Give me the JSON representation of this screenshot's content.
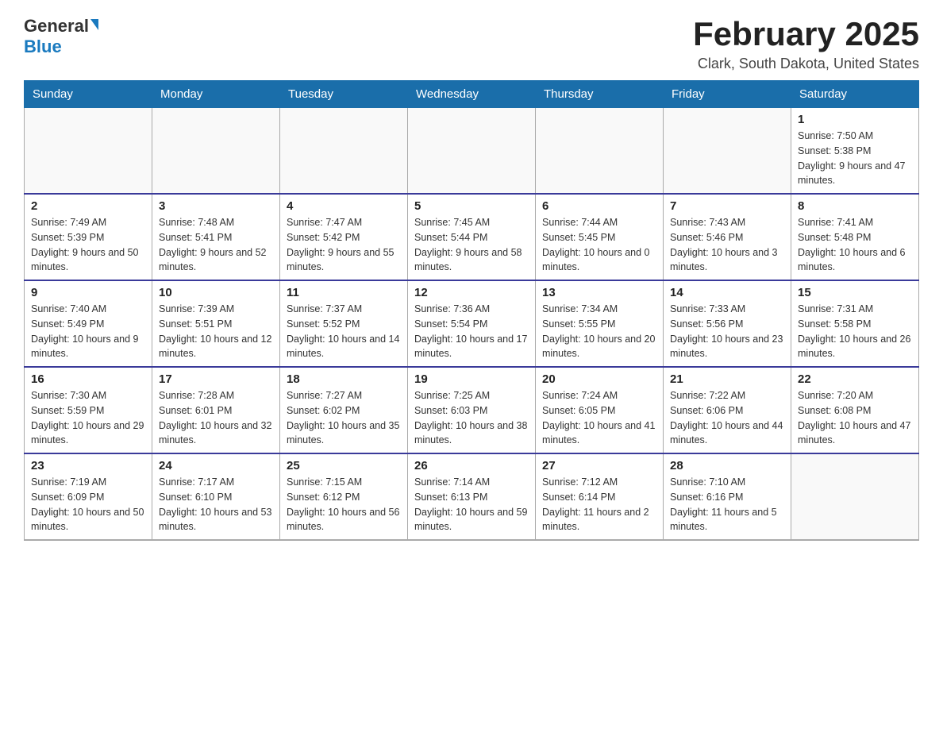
{
  "logo": {
    "general": "General",
    "blue": "Blue"
  },
  "title": {
    "month_year": "February 2025",
    "location": "Clark, South Dakota, United States"
  },
  "headers": [
    "Sunday",
    "Monday",
    "Tuesday",
    "Wednesday",
    "Thursday",
    "Friday",
    "Saturday"
  ],
  "weeks": [
    [
      {
        "day": "",
        "info": ""
      },
      {
        "day": "",
        "info": ""
      },
      {
        "day": "",
        "info": ""
      },
      {
        "day": "",
        "info": ""
      },
      {
        "day": "",
        "info": ""
      },
      {
        "day": "",
        "info": ""
      },
      {
        "day": "1",
        "info": "Sunrise: 7:50 AM\nSunset: 5:38 PM\nDaylight: 9 hours and 47 minutes."
      }
    ],
    [
      {
        "day": "2",
        "info": "Sunrise: 7:49 AM\nSunset: 5:39 PM\nDaylight: 9 hours and 50 minutes."
      },
      {
        "day": "3",
        "info": "Sunrise: 7:48 AM\nSunset: 5:41 PM\nDaylight: 9 hours and 52 minutes."
      },
      {
        "day": "4",
        "info": "Sunrise: 7:47 AM\nSunset: 5:42 PM\nDaylight: 9 hours and 55 minutes."
      },
      {
        "day": "5",
        "info": "Sunrise: 7:45 AM\nSunset: 5:44 PM\nDaylight: 9 hours and 58 minutes."
      },
      {
        "day": "6",
        "info": "Sunrise: 7:44 AM\nSunset: 5:45 PM\nDaylight: 10 hours and 0 minutes."
      },
      {
        "day": "7",
        "info": "Sunrise: 7:43 AM\nSunset: 5:46 PM\nDaylight: 10 hours and 3 minutes."
      },
      {
        "day": "8",
        "info": "Sunrise: 7:41 AM\nSunset: 5:48 PM\nDaylight: 10 hours and 6 minutes."
      }
    ],
    [
      {
        "day": "9",
        "info": "Sunrise: 7:40 AM\nSunset: 5:49 PM\nDaylight: 10 hours and 9 minutes."
      },
      {
        "day": "10",
        "info": "Sunrise: 7:39 AM\nSunset: 5:51 PM\nDaylight: 10 hours and 12 minutes."
      },
      {
        "day": "11",
        "info": "Sunrise: 7:37 AM\nSunset: 5:52 PM\nDaylight: 10 hours and 14 minutes."
      },
      {
        "day": "12",
        "info": "Sunrise: 7:36 AM\nSunset: 5:54 PM\nDaylight: 10 hours and 17 minutes."
      },
      {
        "day": "13",
        "info": "Sunrise: 7:34 AM\nSunset: 5:55 PM\nDaylight: 10 hours and 20 minutes."
      },
      {
        "day": "14",
        "info": "Sunrise: 7:33 AM\nSunset: 5:56 PM\nDaylight: 10 hours and 23 minutes."
      },
      {
        "day": "15",
        "info": "Sunrise: 7:31 AM\nSunset: 5:58 PM\nDaylight: 10 hours and 26 minutes."
      }
    ],
    [
      {
        "day": "16",
        "info": "Sunrise: 7:30 AM\nSunset: 5:59 PM\nDaylight: 10 hours and 29 minutes."
      },
      {
        "day": "17",
        "info": "Sunrise: 7:28 AM\nSunset: 6:01 PM\nDaylight: 10 hours and 32 minutes."
      },
      {
        "day": "18",
        "info": "Sunrise: 7:27 AM\nSunset: 6:02 PM\nDaylight: 10 hours and 35 minutes."
      },
      {
        "day": "19",
        "info": "Sunrise: 7:25 AM\nSunset: 6:03 PM\nDaylight: 10 hours and 38 minutes."
      },
      {
        "day": "20",
        "info": "Sunrise: 7:24 AM\nSunset: 6:05 PM\nDaylight: 10 hours and 41 minutes."
      },
      {
        "day": "21",
        "info": "Sunrise: 7:22 AM\nSunset: 6:06 PM\nDaylight: 10 hours and 44 minutes."
      },
      {
        "day": "22",
        "info": "Sunrise: 7:20 AM\nSunset: 6:08 PM\nDaylight: 10 hours and 47 minutes."
      }
    ],
    [
      {
        "day": "23",
        "info": "Sunrise: 7:19 AM\nSunset: 6:09 PM\nDaylight: 10 hours and 50 minutes."
      },
      {
        "day": "24",
        "info": "Sunrise: 7:17 AM\nSunset: 6:10 PM\nDaylight: 10 hours and 53 minutes."
      },
      {
        "day": "25",
        "info": "Sunrise: 7:15 AM\nSunset: 6:12 PM\nDaylight: 10 hours and 56 minutes."
      },
      {
        "day": "26",
        "info": "Sunrise: 7:14 AM\nSunset: 6:13 PM\nDaylight: 10 hours and 59 minutes."
      },
      {
        "day": "27",
        "info": "Sunrise: 7:12 AM\nSunset: 6:14 PM\nDaylight: 11 hours and 2 minutes."
      },
      {
        "day": "28",
        "info": "Sunrise: 7:10 AM\nSunset: 6:16 PM\nDaylight: 11 hours and 5 minutes."
      },
      {
        "day": "",
        "info": ""
      }
    ]
  ]
}
